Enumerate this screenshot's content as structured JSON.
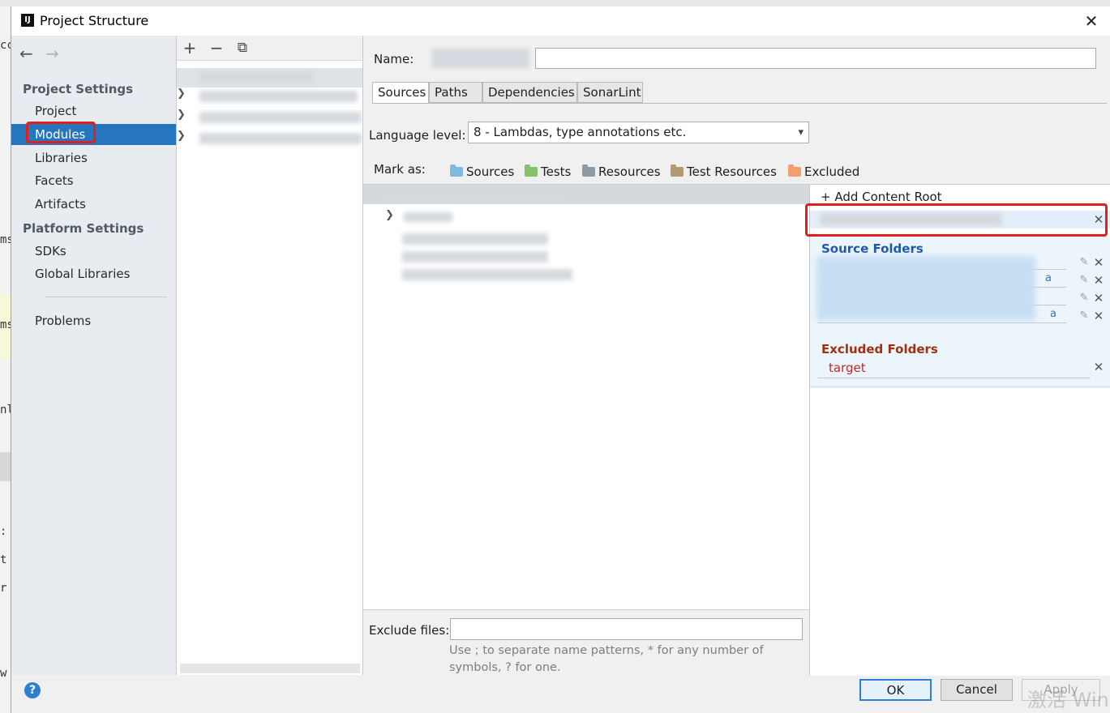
{
  "window": {
    "title": "Project Structure",
    "close_glyph": "✕",
    "app_icon_text": "IJ"
  },
  "nav": {
    "back_glyph": "←",
    "forward_glyph": "→",
    "project_settings_heading": "Project Settings",
    "project_items": [
      "Project",
      "Modules",
      "Libraries",
      "Facets",
      "Artifacts"
    ],
    "selected_item": "Modules",
    "platform_settings_heading": "Platform Settings",
    "platform_items": [
      "SDKs",
      "Global Libraries"
    ],
    "problems": "Problems"
  },
  "tree_toolbar": {
    "add": "+",
    "remove": "−",
    "copy": "⧉"
  },
  "module": {
    "name_label": "Name:",
    "tabs": [
      "Sources",
      "Paths",
      "Dependencies",
      "SonarLint"
    ],
    "selected_tab": "Sources",
    "language_level_label": "Language level:",
    "language_level_value": "8 - Lambdas, type annotations etc.",
    "mark_as_label": "Mark as:",
    "mark_as": [
      {
        "label": "Sources",
        "color": "#7db9e0"
      },
      {
        "label": "Tests",
        "color": "#86c26a"
      },
      {
        "label": "Resources",
        "color": "#8e9aa6"
      },
      {
        "label": "Test Resources",
        "color": "#b39a6e"
      },
      {
        "label": "Excluded",
        "color": "#f0a070"
      }
    ],
    "exclude_files_label": "Exclude files:",
    "exclude_files_hint": "Use ; to separate name patterns, * for any number of symbols, ? for one."
  },
  "content_root": {
    "add_label": "+ Add Content Root",
    "source_folders_heading": "Source Folders",
    "source_folder_fragments": [
      "a",
      "a"
    ],
    "excluded_folders_heading": "Excluded Folders",
    "excluded_folders": [
      "target"
    ],
    "remove_glyph": "✕",
    "edit_glyph": "✎"
  },
  "buttons": {
    "ok": "OK",
    "cancel": "Cancel",
    "apply": "Apply",
    "help": "?"
  },
  "watermark": "激活 Win",
  "colors": {
    "selection": "#2675bf",
    "highlight_box": "#e21f1f",
    "source_heading": "#1a57a6",
    "excluded_heading": "#a0300f"
  }
}
